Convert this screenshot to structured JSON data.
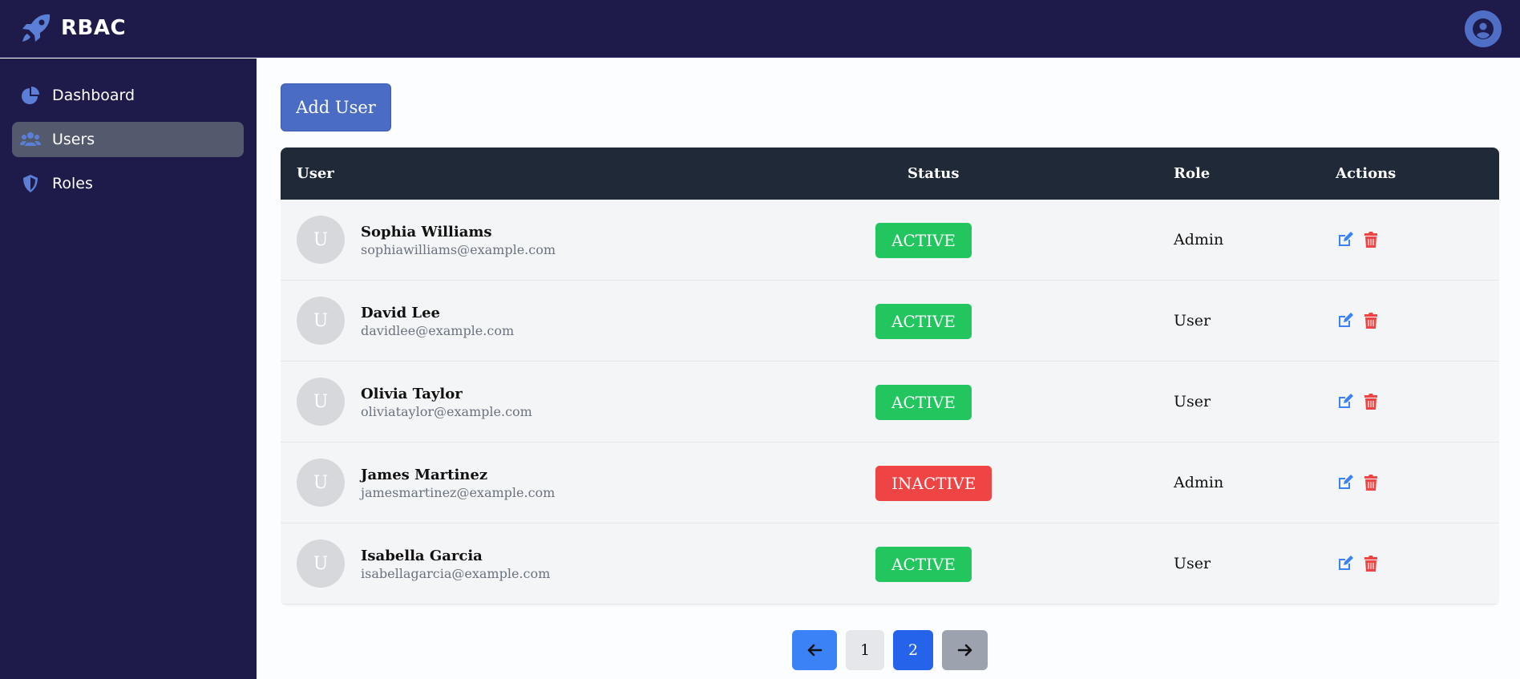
{
  "app": {
    "brand": "RBAC",
    "brand_icon": "rocket-icon",
    "profile_icon": "user-circle-icon"
  },
  "colors": {
    "sidebar_bg": "#1e1b4b",
    "accent": "#4a6cc4",
    "active_badge": "#22c55e",
    "inactive_badge": "#ef4444",
    "edit_icon": "#3b82f6",
    "delete_icon": "#ef4444"
  },
  "sidebar": {
    "items": [
      {
        "label": "Dashboard",
        "icon": "pie-chart-icon",
        "active": false
      },
      {
        "label": "Users",
        "icon": "users-icon",
        "active": true
      },
      {
        "label": "Roles",
        "icon": "shield-icon",
        "active": false
      }
    ]
  },
  "main": {
    "add_user_label": "Add User",
    "table": {
      "headers": {
        "user": "User",
        "status": "Status",
        "role": "Role",
        "actions": "Actions"
      },
      "rows": [
        {
          "avatar": "U",
          "name": "Sophia Williams",
          "email": "sophiawilliams@example.com",
          "status": "ACTIVE",
          "role": "Admin"
        },
        {
          "avatar": "U",
          "name": "David Lee",
          "email": "davidlee@example.com",
          "status": "ACTIVE",
          "role": "User"
        },
        {
          "avatar": "U",
          "name": "Olivia Taylor",
          "email": "oliviataylor@example.com",
          "status": "ACTIVE",
          "role": "User"
        },
        {
          "avatar": "U",
          "name": "James Martinez",
          "email": "jamesmartinez@example.com",
          "status": "INACTIVE",
          "role": "Admin"
        },
        {
          "avatar": "U",
          "name": "Isabella Garcia",
          "email": "isabellagarcia@example.com",
          "status": "ACTIVE",
          "role": "User"
        }
      ]
    },
    "pagination": {
      "prev_icon": "arrow-left-icon",
      "pages": [
        "1",
        "2"
      ],
      "current": "2",
      "next_icon": "arrow-right-icon"
    }
  }
}
